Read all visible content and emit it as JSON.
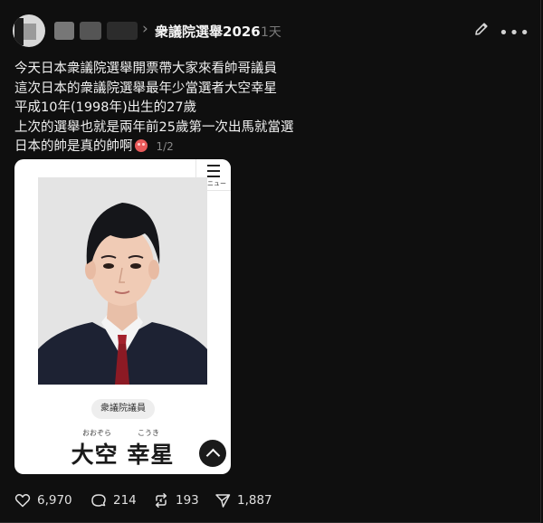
{
  "post": {
    "community": "衆議院選舉2026",
    "time": "1天",
    "lines": [
      "今天日本衆議院選舉開票帶大家來看帥哥議員",
      "這次日本的衆議院選舉最年少當選者大空幸星",
      "平成10年(1998年)出生的27歲",
      "上次的選舉也就是兩年前25歲第一次出馬就當選",
      "日本的帥是真的帥啊"
    ],
    "pager": "1/2"
  },
  "card": {
    "menu_label": "メニュー",
    "badge": "衆議院議員",
    "furigana_family": "おおぞら",
    "furigana_given": "こうき",
    "name": "大空 幸星"
  },
  "actions": {
    "likes": "6,970",
    "comments": "214",
    "reposts": "193",
    "shares": "1,887"
  },
  "icons": {
    "edit": "pencil-icon",
    "more": "more-icon",
    "like": "heart-icon",
    "comment": "comment-icon",
    "repost": "repost-icon",
    "share": "send-icon"
  }
}
